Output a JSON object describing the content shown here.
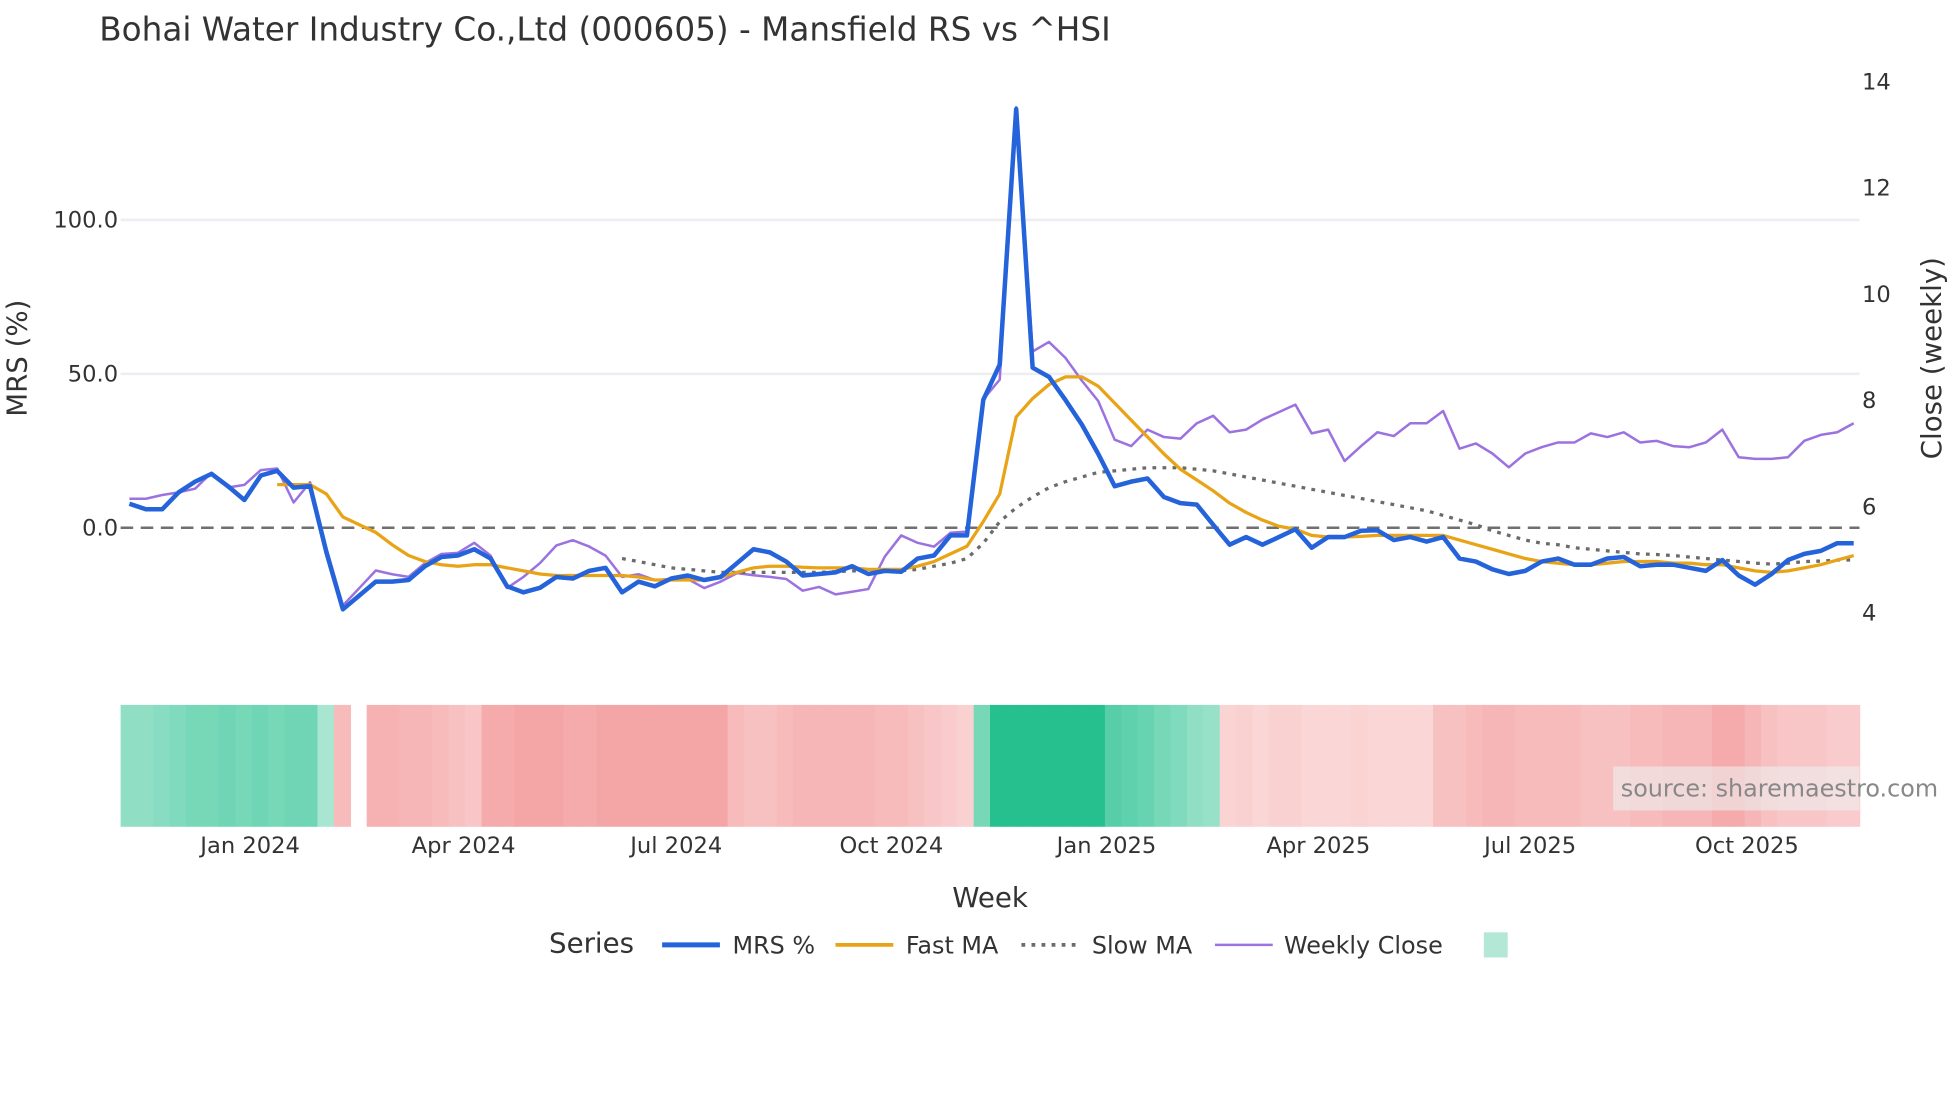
{
  "chart_data": {
    "type": "line",
    "title": "Bohai Water Industry Co.,Ltd (000605) - Mansfield RS vs ^HSI",
    "xlabel": "Week",
    "ylabel": "MRS (%)",
    "y2label": "Close (weekly)",
    "x_weeks": 106,
    "x_ticks": [
      {
        "label": "Jan 2024",
        "week": 7.35
      },
      {
        "label": "Apr 2024",
        "week": 20.35
      },
      {
        "label": "Jul 2024",
        "week": 33.3
      },
      {
        "label": "Oct 2024",
        "week": 46.4
      },
      {
        "label": "Jan 2025",
        "week": 59.5
      },
      {
        "label": "Apr 2025",
        "week": 72.4
      },
      {
        "label": "Jul 2025",
        "week": 85.3
      },
      {
        "label": "Oct 2025",
        "week": 98.5
      }
    ],
    "y_ticks": [
      "0.0",
      "50.0",
      "100.0"
    ],
    "y_tick_values": [
      0,
      50,
      100
    ],
    "y2_ticks": [
      "4",
      "6",
      "8",
      "10",
      "12",
      "14"
    ],
    "y2_tick_values": [
      4,
      6,
      8,
      10,
      12,
      14
    ],
    "ylim": [
      -30,
      140
    ],
    "y2lim": [
      3.2,
      14.5
    ],
    "zero_line": 0,
    "grid": true,
    "legend_title": "Series",
    "legend_placement": "bottom",
    "series": [
      {
        "name": "MRS %",
        "axis": "left",
        "color": "#2563db",
        "start": 0,
        "values": [
          7.8,
          6,
          6,
          11.5,
          15,
          17.5,
          13.5,
          9,
          17,
          18.5,
          13,
          13.5,
          -8,
          -26.5,
          -22,
          -17.5,
          -17.5,
          -17,
          -12.5,
          -9.5,
          -9,
          -7,
          -10,
          -19,
          -21,
          -19.5,
          -16,
          -16.5,
          -14,
          -13,
          -21,
          -17.5,
          -19,
          -16.5,
          -15.5,
          -17,
          -16,
          -11.5,
          -7,
          -8,
          -11,
          -15.5,
          -15,
          -14.5,
          -12.5,
          -15,
          -14,
          -14.3,
          -10,
          -9,
          -2.5,
          -2.5,
          41.5,
          53,
          136,
          52,
          49,
          41.5,
          33.5,
          24,
          13.5,
          15,
          16,
          10,
          8,
          7.5,
          1,
          -5.5,
          -3,
          -5.5,
          -3,
          -0.5,
          -6.5,
          -3,
          -3,
          -1,
          -0.8,
          -4,
          -3,
          -4.5,
          -3,
          -10,
          -11,
          -13.5,
          -15,
          -14,
          -11,
          -10,
          -12,
          -12,
          -10,
          -9.5,
          -12.5,
          -12,
          -12,
          -13,
          -14,
          -10.5,
          -15.5,
          -18.5,
          -15,
          -10.5,
          -8.5,
          -7.5,
          -5,
          -5
        ]
      },
      {
        "name": "Fast MA",
        "axis": "left",
        "color": "#e8a317",
        "start": 9,
        "values": [
          14,
          14,
          14,
          11,
          3.5,
          1,
          -1.5,
          -5.5,
          -9,
          -11,
          -12,
          -12.5,
          -12,
          -12,
          -13,
          -14,
          -15,
          -15.5,
          -15.5,
          -15.5,
          -15.5,
          -15.5,
          -16,
          -17,
          -17,
          -17,
          -17,
          -16,
          -14.5,
          -13,
          -12.5,
          -12.5,
          -12.8,
          -13,
          -13,
          -13,
          -13.5,
          -13.5,
          -13.5,
          -12.5,
          -11,
          -8.5,
          -6,
          2,
          11,
          36,
          42,
          46.5,
          49,
          49,
          46,
          40.5,
          35,
          29.5,
          24,
          19,
          15.5,
          12,
          8,
          5,
          2.5,
          0.5,
          -0.5,
          -2.5,
          -3,
          -3,
          -2.8,
          -2.5,
          -2.5,
          -2.5,
          -2.5,
          -2.5,
          -4,
          -5.5,
          -7,
          -8.5,
          -10,
          -11,
          -11.5,
          -12,
          -12,
          -11.5,
          -11,
          -11,
          -11,
          -11.5,
          -11.5,
          -12,
          -12,
          -13,
          -14,
          -14.5,
          -14,
          -13,
          -12,
          -10.5,
          -9
        ]
      },
      {
        "name": "Slow MA",
        "axis": "left",
        "color": "#6b6b6b",
        "dash": true,
        "start": 30,
        "values": [
          -10,
          -11,
          -12,
          -13,
          -13.5,
          -14,
          -14.5,
          -14.5,
          -14.5,
          -14.5,
          -14.5,
          -14.5,
          -14.5,
          -14.3,
          -14,
          -14,
          -14,
          -14,
          -13.5,
          -12.5,
          -11.5,
          -10,
          -5,
          2,
          6.5,
          10,
          13,
          15,
          16.5,
          18,
          18.5,
          19,
          19.5,
          19.5,
          19.5,
          19,
          18.5,
          17.5,
          16.5,
          15.5,
          14.5,
          13.5,
          12.5,
          11.5,
          10.5,
          9.5,
          8.5,
          7.5,
          6.5,
          5.5,
          4,
          2.5,
          1,
          -1,
          -2.5,
          -4,
          -5,
          -5.5,
          -6.5,
          -7,
          -7.5,
          -8,
          -8.5,
          -8.7,
          -9,
          -9.5,
          -10,
          -10.5,
          -11,
          -11.5,
          -11.8,
          -11.5,
          -11,
          -10.8,
          -10.5,
          -10.5
        ]
      },
      {
        "name": "Weekly Close",
        "axis": "right",
        "color": "#9b72e0",
        "start": 0,
        "values": [
          6.13,
          6.13,
          6.2,
          6.25,
          6.32,
          6.62,
          6.34,
          6.39,
          6.67,
          6.7,
          6.06,
          6.44,
          5.2,
          4.12,
          4.45,
          4.78,
          4.71,
          4.66,
          4.92,
          5.09,
          5.11,
          5.3,
          5.06,
          4.45,
          4.66,
          4.92,
          5.25,
          5.35,
          5.23,
          5.06,
          4.66,
          4.71,
          4.6,
          4.62,
          4.62,
          4.45,
          4.57,
          4.73,
          4.69,
          4.66,
          4.62,
          4.4,
          4.47,
          4.33,
          4.38,
          4.43,
          5.04,
          5.44,
          5.3,
          5.23,
          5.49,
          5.51,
          8.0,
          8.37,
          13.5,
          8.9,
          9.08,
          8.78,
          8.35,
          7.97,
          7.24,
          7.12,
          7.43,
          7.29,
          7.26,
          7.55,
          7.69,
          7.38,
          7.43,
          7.62,
          7.76,
          7.9,
          7.36,
          7.43,
          6.84,
          7.12,
          7.38,
          7.31,
          7.55,
          7.55,
          7.78,
          7.07,
          7.17,
          6.98,
          6.72,
          6.98,
          7.1,
          7.19,
          7.19,
          7.36,
          7.29,
          7.38,
          7.19,
          7.22,
          7.12,
          7.1,
          7.19,
          7.43,
          6.91,
          6.88,
          6.88,
          6.91,
          7.22,
          7.33,
          7.38,
          7.55
        ]
      }
    ],
    "heatmap": {
      "positive_color": "#26c08e",
      "negative_color": "#f39a9b",
      "values": [
        0.35,
        0.35,
        0.4,
        0.45,
        0.5,
        0.5,
        0.55,
        0.5,
        0.55,
        0.5,
        0.55,
        0.55,
        0.2,
        -0.4,
        null,
        -0.5,
        -0.5,
        -0.45,
        -0.45,
        -0.4,
        -0.35,
        -0.3,
        -0.55,
        -0.55,
        -0.6,
        -0.6,
        -0.6,
        -0.55,
        -0.55,
        -0.6,
        -0.6,
        -0.6,
        -0.6,
        -0.6,
        -0.6,
        -0.6,
        -0.6,
        -0.4,
        -0.35,
        -0.35,
        -0.4,
        -0.45,
        -0.45,
        -0.45,
        -0.45,
        -0.45,
        -0.4,
        -0.4,
        -0.35,
        -0.3,
        -0.25,
        -0.2,
        0.5,
        1,
        1,
        1,
        1,
        1,
        1,
        1,
        0.7,
        0.65,
        0.6,
        0.5,
        0.45,
        0.35,
        0.3,
        -0.18,
        -0.2,
        -0.15,
        -0.2,
        -0.2,
        -0.15,
        -0.15,
        -0.15,
        -0.18,
        -0.15,
        -0.15,
        -0.15,
        -0.15,
        -0.35,
        -0.35,
        -0.4,
        -0.45,
        -0.45,
        -0.4,
        -0.4,
        -0.4,
        -0.4,
        -0.35,
        -0.35,
        -0.35,
        -0.4,
        -0.4,
        -0.45,
        -0.45,
        -0.45,
        -0.55,
        -0.55,
        -0.45,
        -0.35,
        -0.3,
        -0.3,
        -0.3,
        -0.25,
        -0.25
      ]
    },
    "annotation": "source: sharemaestro.com"
  }
}
